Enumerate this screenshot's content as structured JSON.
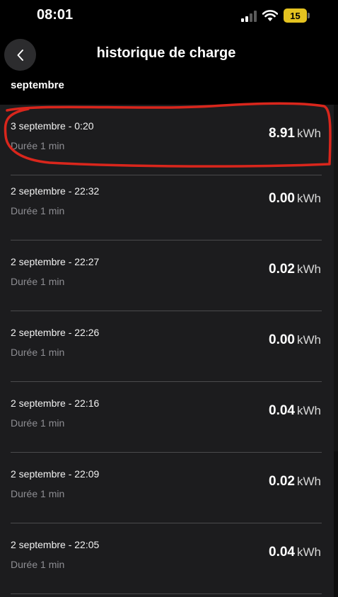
{
  "status_bar": {
    "time": "08:01",
    "battery_level": "15",
    "icons": [
      "signal-icon",
      "wifi-icon",
      "battery-icon"
    ],
    "battery_color": "#e5c320"
  },
  "header": {
    "back_icon": "chevron-left-icon",
    "title": "historique de charge"
  },
  "section": {
    "label": "septembre"
  },
  "sessions": [
    {
      "date": "3 septembre - 0:20",
      "duration": "Durée 1 min",
      "energy": "8.91",
      "unit": "kWh"
    },
    {
      "date": "2 septembre - 22:32",
      "duration": "Durée 1 min",
      "energy": "0.00",
      "unit": "kWh"
    },
    {
      "date": "2 septembre - 22:27",
      "duration": "Durée 1 min",
      "energy": "0.02",
      "unit": "kWh"
    },
    {
      "date": "2 septembre - 22:26",
      "duration": "Durée 1 min",
      "energy": "0.00",
      "unit": "kWh"
    },
    {
      "date": "2 septembre - 22:16",
      "duration": "Durée 1 min",
      "energy": "0.04",
      "unit": "kWh"
    },
    {
      "date": "2 septembre - 22:09",
      "duration": "Durée 1 min",
      "energy": "0.02",
      "unit": "kWh"
    },
    {
      "date": "2 septembre - 22:05",
      "duration": "Durée 1 min",
      "energy": "0.04",
      "unit": "kWh"
    }
  ],
  "colors": {
    "background": "#000000",
    "list_background": "#1c1c1e",
    "secondary_text": "#8e8e93",
    "highlight_annotation": "#d9261c"
  }
}
